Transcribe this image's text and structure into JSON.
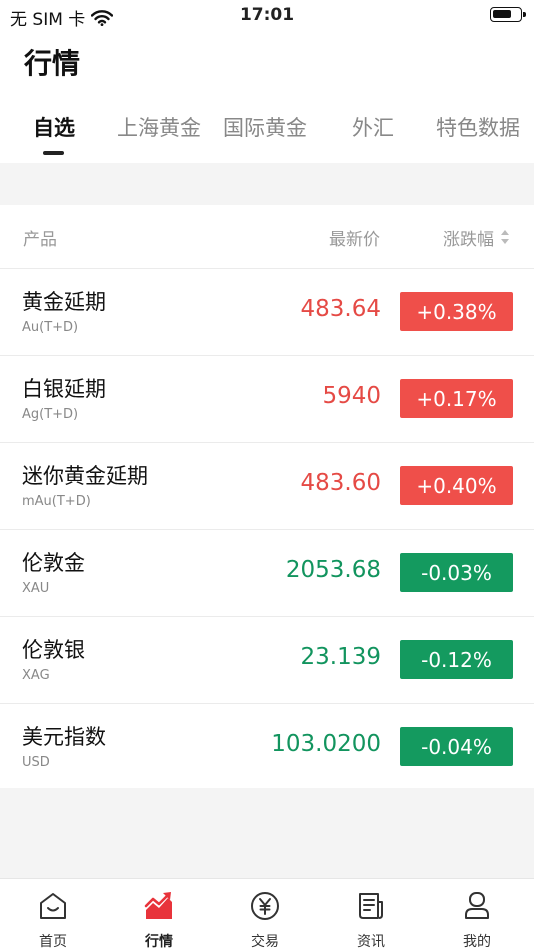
{
  "status_bar": {
    "carrier": "无 SIM 卡",
    "time": "17:01"
  },
  "page": {
    "title": "行情"
  },
  "tabs": [
    {
      "label": "自选",
      "active": true
    },
    {
      "label": "上海黄金",
      "active": false
    },
    {
      "label": "国际黄金",
      "active": false
    },
    {
      "label": "外汇",
      "active": false
    },
    {
      "label": "特色数据",
      "active": false
    }
  ],
  "list": {
    "headers": {
      "product": "产品",
      "price": "最新价",
      "change": "涨跌幅"
    },
    "rows": [
      {
        "name": "黄金延期",
        "code": "Au(T+D)",
        "price": "483.64",
        "change": "+0.38%",
        "direction": "up"
      },
      {
        "name": "白银延期",
        "code": "Ag(T+D)",
        "price": "5940",
        "change": "+0.17%",
        "direction": "up"
      },
      {
        "name": "迷你黄金延期",
        "code": "mAu(T+D)",
        "price": "483.60",
        "change": "+0.40%",
        "direction": "up"
      },
      {
        "name": "伦敦金",
        "code": "XAU",
        "price": "2053.68",
        "change": "-0.03%",
        "direction": "down"
      },
      {
        "name": "伦敦银",
        "code": "XAG",
        "price": "23.139",
        "change": "-0.12%",
        "direction": "down"
      },
      {
        "name": "美元指数",
        "code": "USD",
        "price": "103.0200",
        "change": "-0.04%",
        "direction": "down"
      }
    ]
  },
  "tabbar": [
    {
      "label": "首页",
      "icon": "home-icon",
      "active": false
    },
    {
      "label": "行情",
      "icon": "market-chart-icon",
      "active": true
    },
    {
      "label": "交易",
      "icon": "yuan-coin-icon",
      "active": false
    },
    {
      "label": "资讯",
      "icon": "news-document-icon",
      "active": false
    },
    {
      "label": "我的",
      "icon": "user-profile-icon",
      "active": false
    }
  ],
  "colors": {
    "up": "#ef4f4a",
    "down": "#149a5f",
    "accent": "#e8333b"
  }
}
